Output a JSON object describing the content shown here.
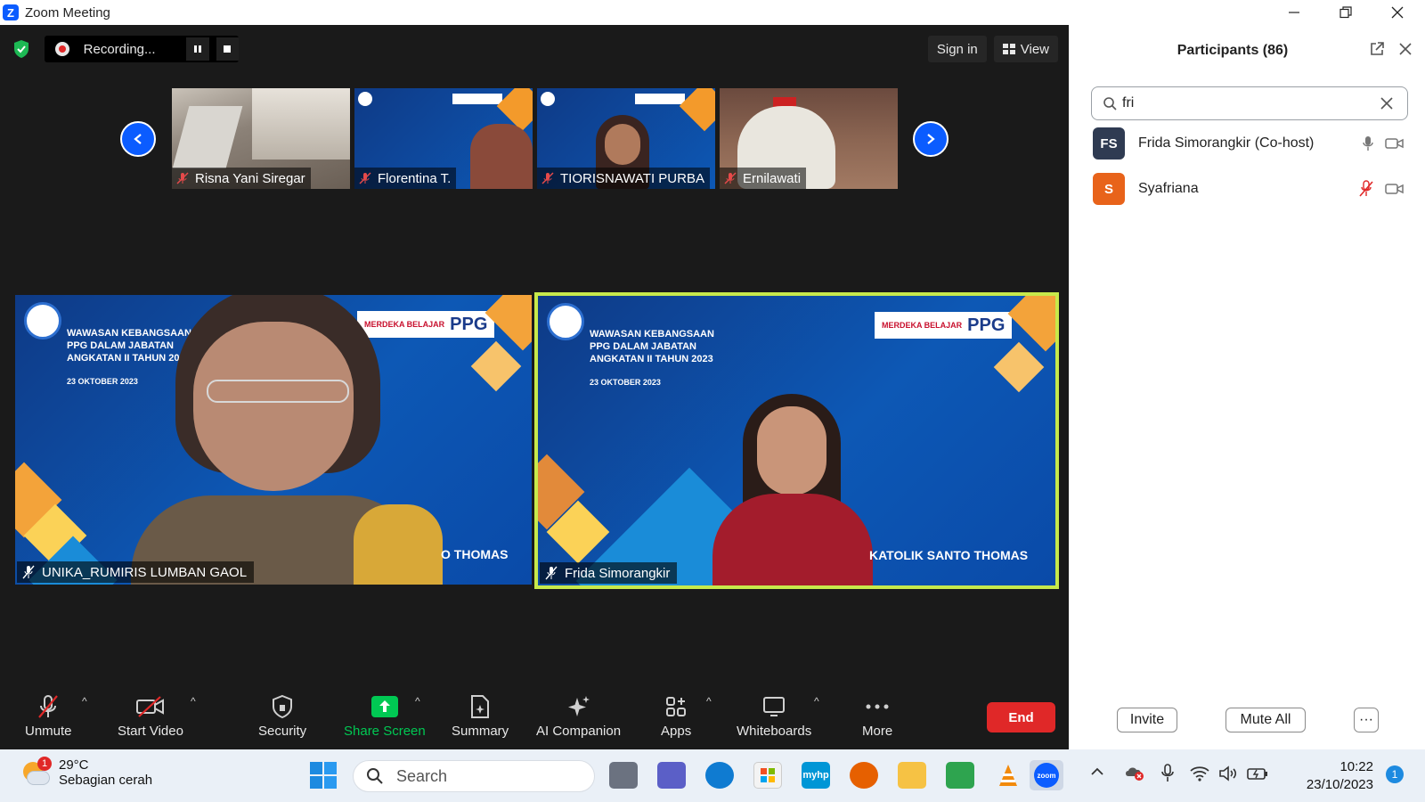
{
  "window": {
    "title": "Zoom Meeting"
  },
  "meeting": {
    "recording_label": "Recording...",
    "sign_in_label": "Sign in",
    "view_label": "View"
  },
  "thumbnails": [
    {
      "name": "Risna Yani Siregar"
    },
    {
      "name": "Florentina T."
    },
    {
      "name": "TIORISNAWATI PURBA"
    },
    {
      "name": "Ernilawati"
    }
  ],
  "tiles": [
    {
      "name": "UNIKA_RUMIRIS LUMBAN GAOL",
      "title_lines": [
        "WAWASAN KEBANGSAAN",
        "PPG DALAM JABATAN",
        "ANGKATAN II TAHUN 20"
      ],
      "date": "23 OKTOBER 2023",
      "footer": "O THOMAS",
      "ppg_small": "MERDEKA BELAJAR",
      "ppg_big": "PPG"
    },
    {
      "name": "Frida Simorangkir",
      "title_lines": [
        "WAWASAN KEBANGSAAN",
        "PPG DALAM JABATAN",
        "ANGKATAN II TAHUN 2023"
      ],
      "date": "23 OKTOBER 2023",
      "footer": "KATOLIK SANTO THOMAS",
      "ppg_small": "MERDEKA BELAJAR",
      "ppg_big": "PPG"
    }
  ],
  "toolbar": {
    "unmute": "Unmute",
    "start_video": "Start Video",
    "security": "Security",
    "share_screen": "Share Screen",
    "summary": "Summary",
    "ai_companion": "AI Companion",
    "apps": "Apps",
    "whiteboards": "Whiteboards",
    "more": "More",
    "end": "End"
  },
  "participants_panel": {
    "title": "Participants (86)",
    "search_value": "fri",
    "items": [
      {
        "initials": "FS",
        "name": "Frida Simorangkir (Co-host)",
        "avatar_color": "#2f3b52",
        "mic": "on"
      },
      {
        "initials": "S",
        "name": "Syafriana",
        "avatar_color": "#e8631a",
        "mic": "muted"
      }
    ],
    "invite_label": "Invite",
    "mute_all_label": "Mute All",
    "more_label": "···"
  },
  "taskbar": {
    "weather_temp": "29°C",
    "weather_desc": "Sebagian cerah",
    "weather_badge": "1",
    "search_placeholder": "Search",
    "time": "10:22",
    "date": "23/10/2023",
    "notification_count": "1"
  },
  "colors": {
    "zoom_blue": "#0b5cff",
    "end_red": "#e02828",
    "share_green": "#00c853",
    "active_speaker": "#c7e94b"
  }
}
